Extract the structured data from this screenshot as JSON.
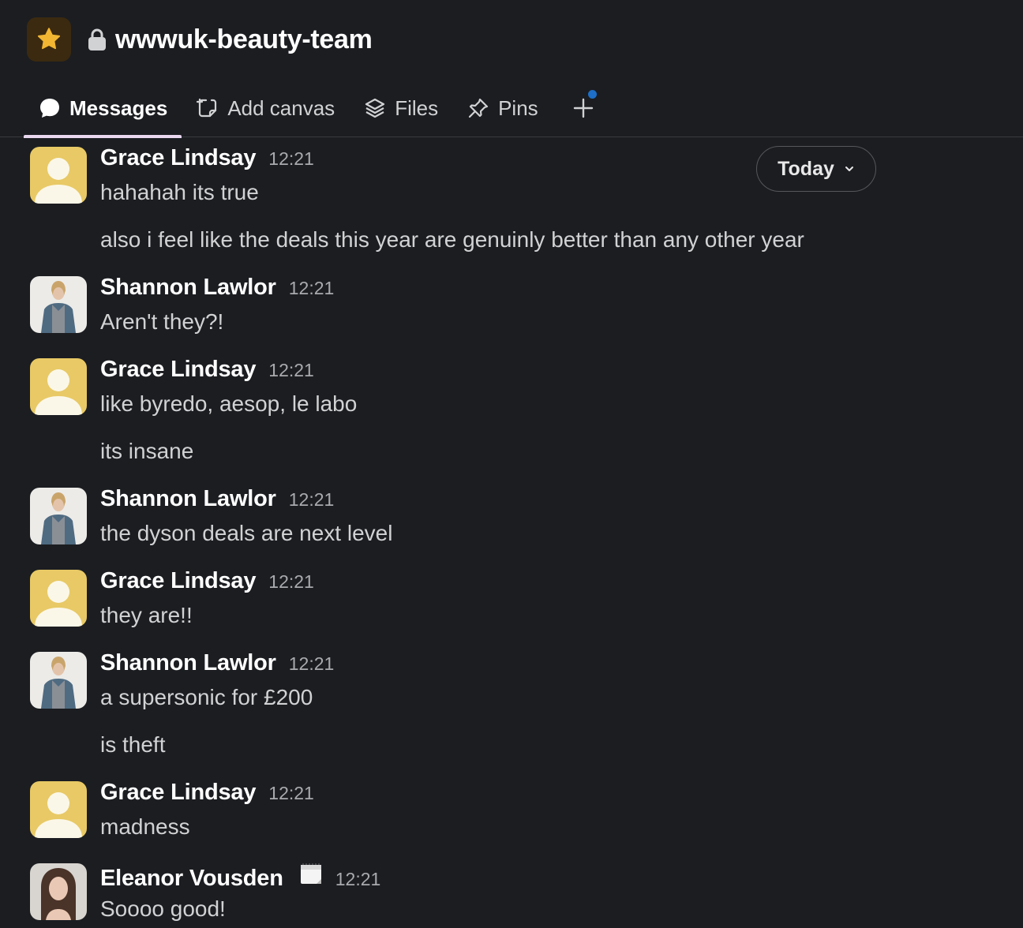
{
  "channel": {
    "name": "wwwuk-beauty-team",
    "workspace_icon": "star-icon",
    "privacy_icon": "lock-icon"
  },
  "tabs": [
    {
      "label": "Messages",
      "icon": "message-bubble-icon",
      "active": true
    },
    {
      "label": "Add canvas",
      "icon": "canvas-add-icon"
    },
    {
      "label": "Files",
      "icon": "layers-icon"
    },
    {
      "label": "Pins",
      "icon": "pin-icon"
    }
  ],
  "date_divider": {
    "label": "Today"
  },
  "messages": [
    {
      "sender": "Grace Lindsay",
      "time": "12:21",
      "lines": [
        "hahahah its true",
        "also i feel like the deals this year are genuinly better than any other year"
      ]
    },
    {
      "sender": "Shannon Lawlor",
      "time": "12:21",
      "lines": [
        "Aren't they?!"
      ]
    },
    {
      "sender": "Grace Lindsay",
      "time": "12:21",
      "lines": [
        "like byredo, aesop, le labo",
        "its insane"
      ]
    },
    {
      "sender": "Shannon Lawlor",
      "time": "12:21",
      "lines": [
        "the dyson deals are next level"
      ]
    },
    {
      "sender": "Grace Lindsay",
      "time": "12:21",
      "lines": [
        "they are!!"
      ]
    },
    {
      "sender": "Shannon Lawlor",
      "time": "12:21",
      "lines": [
        "a supersonic for £200",
        "is theft"
      ]
    },
    {
      "sender": "Grace Lindsay",
      "time": "12:21",
      "lines": [
        "madness"
      ]
    },
    {
      "sender": "Eleanor Vousden",
      "time": "12:21",
      "status_icon": "calendar-icon",
      "lines": [
        "Soooo good!"
      ]
    }
  ],
  "colors": {
    "background": "#1b1d21",
    "default_avatar": "#e8c965",
    "active_tab_underline": "#e8d7ee",
    "notification_dot": "#1d6fc7"
  }
}
